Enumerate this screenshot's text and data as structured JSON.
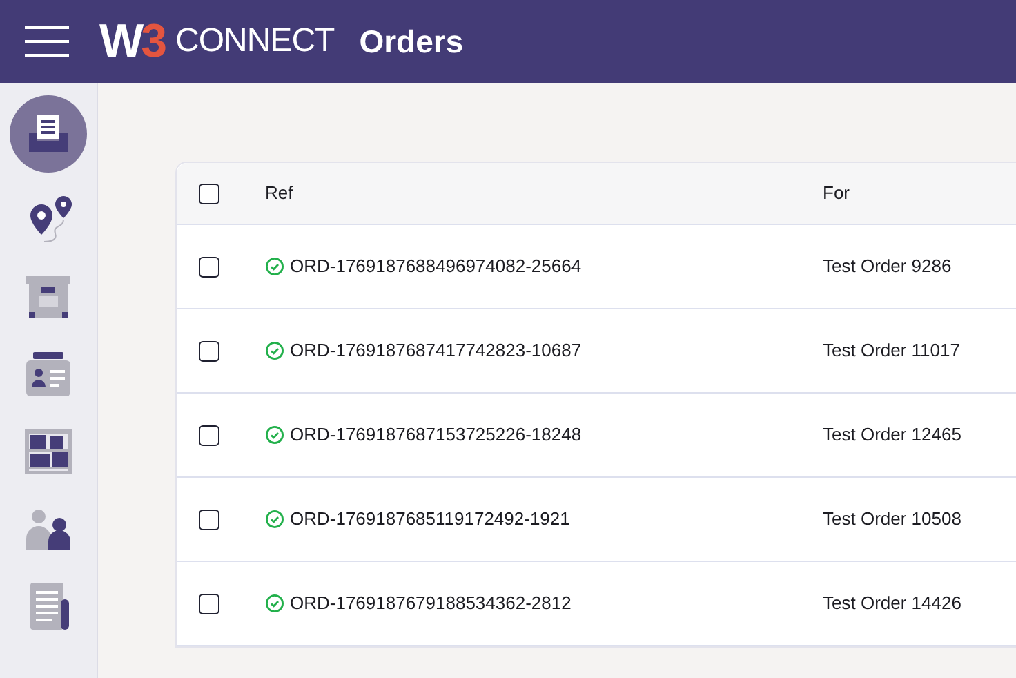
{
  "header": {
    "logo_mark": "W",
    "logo_accent": "3",
    "logo_word": "CONNECT",
    "title": "Orders"
  },
  "sidebar": {
    "items": [
      {
        "kind": "inbox",
        "selected": true
      },
      {
        "kind": "route",
        "selected": false
      },
      {
        "kind": "archive",
        "selected": false
      },
      {
        "kind": "contact",
        "selected": false
      },
      {
        "kind": "shelves",
        "selected": false
      },
      {
        "kind": "people",
        "selected": false
      },
      {
        "kind": "document",
        "selected": false
      }
    ]
  },
  "table": {
    "select_all": {
      "checked": false
    },
    "columns": [
      "Ref",
      "For"
    ],
    "rows": [
      {
        "checked": false,
        "kind": "complete",
        "ref": "ORD-1769187688496974082-25664",
        "for": "Test Order 9286"
      },
      {
        "checked": false,
        "kind": "complete",
        "ref": "ORD-1769187687417742823-10687",
        "for": "Test Order 11017"
      },
      {
        "checked": false,
        "kind": "complete",
        "ref": "ORD-1769187687153725226-18248",
        "for": "Test Order 12465"
      },
      {
        "checked": false,
        "kind": "complete",
        "ref": "ORD-1769187685119172492-1921",
        "for": "Test Order 10508"
      },
      {
        "checked": false,
        "kind": "complete",
        "ref": "ORD-1769187679188534362-2812",
        "for": "Test Order 14426"
      }
    ]
  }
}
